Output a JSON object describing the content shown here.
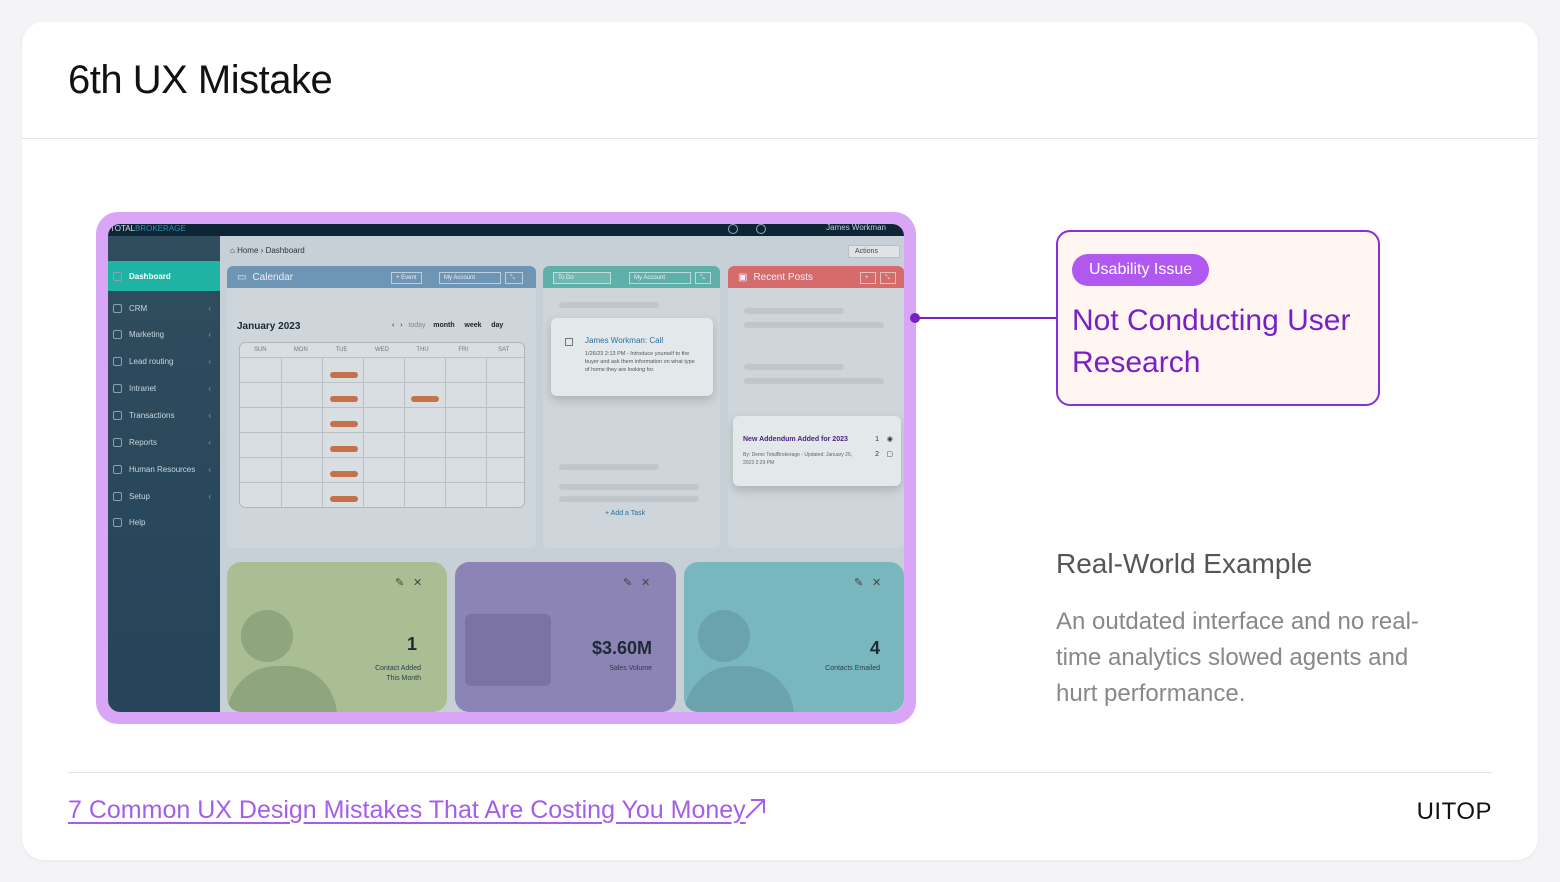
{
  "header": {
    "title": "6th UX Mistake"
  },
  "screenshot": {
    "topbar": {
      "brand_prefix": "TOTAL",
      "brand_suffix": "BROKERAGE",
      "user": "James Workman"
    },
    "sidebar": {
      "items": [
        {
          "label": "Dashboard",
          "icon": "home-icon"
        },
        {
          "label": "CRM",
          "icon": "users-icon"
        },
        {
          "label": "Marketing",
          "icon": "mail-icon"
        },
        {
          "label": "Lead routing",
          "icon": "routing-icon"
        },
        {
          "label": "Intranet",
          "icon": "globe-icon"
        },
        {
          "label": "Transactions",
          "icon": "box-icon"
        },
        {
          "label": "Reports",
          "icon": "chart-icon"
        },
        {
          "label": "Human Resources",
          "icon": "people-icon"
        },
        {
          "label": "Setup",
          "icon": "gear-icon"
        },
        {
          "label": "Help",
          "icon": "help-icon"
        }
      ]
    },
    "breadcrumb": {
      "home": "Home",
      "sep": "›",
      "current": "Dashboard"
    },
    "actions_label": "Actions",
    "calendar": {
      "title": "Calendar",
      "event_btn": "+ Event",
      "account_btn": "My Account",
      "month_label": "January 2023",
      "nav": {
        "prev": "‹",
        "next": "›",
        "today": "today",
        "month": "month",
        "week": "week",
        "day": "day"
      },
      "days": [
        "SUN",
        "MON",
        "TUE",
        "WED",
        "THU",
        "FRI",
        "SAT"
      ]
    },
    "todo": {
      "todo_btn": "To Do",
      "account_btn": "My Account",
      "task_name": "James Workman: Call",
      "task_desc": "1/26/23 2:13 PM - Introduce yourself to the buyer and ask them information on what type of home they are looking for.",
      "add_task": "+ Add a Task"
    },
    "posts": {
      "title": "Recent Posts",
      "post_title": "New Addendum Added for 2023",
      "post_meta": "By: Demo TotalBrokerage - Updated: January 26, 2023 2:29 PM",
      "views": "1",
      "comments": "2"
    },
    "stats": [
      {
        "value": "1",
        "label_line1": "Contact Added",
        "label_line2": "This Month",
        "color": "#a9bf93"
      },
      {
        "value": "$3.60M",
        "label_line1": "Sales Volume",
        "label_line2": "",
        "color": "#8c84b4"
      },
      {
        "value": "4",
        "label_line1": "Contacts Emailed",
        "label_line2": "",
        "color": "#79b7bf"
      }
    ]
  },
  "callout": {
    "badge": "Usability Issue",
    "title": "Not Conducting User Research"
  },
  "real_world": {
    "title": "Real-World Example",
    "description": "An outdated interface and no real-time analytics slowed agents and hurt performance."
  },
  "footer": {
    "link_text": "7 Common UX Design Mistakes That Are Costing You Money",
    "brand": "UITOP"
  },
  "colors": {
    "accent": "#7a1fc6",
    "badge": "#b158f0",
    "frame": "#d9a6f7",
    "link": "#a55ee8"
  }
}
